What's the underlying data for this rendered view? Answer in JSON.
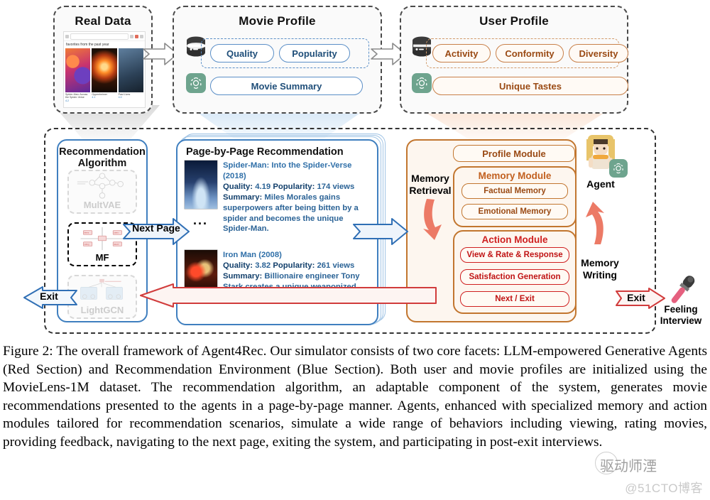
{
  "figure": {
    "top_panels": [
      {
        "id": "real-data",
        "title": "Real Data"
      },
      {
        "id": "movie-profile",
        "title": "Movie Profile"
      },
      {
        "id": "user-profile",
        "title": "User Profile"
      }
    ],
    "real_data": {
      "search_placeholder": "",
      "subheading": "favorites from the past year",
      "movies": [
        {
          "title": "Spider-Man: Across the Spider-Verse",
          "rating": "4.2"
        },
        {
          "title": "Oppenheimer",
          "rating": "4.1"
        },
        {
          "title": "Past Lives",
          "rating": "4.0"
        }
      ]
    },
    "movie_profile": {
      "attributes": [
        "Quality",
        "Popularity"
      ],
      "summary_label": "Movie Summary",
      "db_icon": "database-icon",
      "llm_icon": "openai-logo-icon"
    },
    "user_profile": {
      "attributes": [
        "Activity",
        "Conformity",
        "Diversity"
      ],
      "tastes_label": "Unique Tastes",
      "db_icon": "database-icon",
      "llm_icon": "openai-logo-icon"
    },
    "recommendation_algorithm": {
      "title_line1": "Recommendation",
      "title_line2": "Algorithm",
      "options": [
        {
          "label": "MultVAE",
          "active": false
        },
        {
          "label": "MF",
          "active": true
        },
        {
          "label": "LightGCN",
          "active": false
        }
      ]
    },
    "page_recommendation": {
      "title": "Page-by-Page Recommendation",
      "ellipsis": "...",
      "items": [
        {
          "title": "Spider-Man: Into the Spider-Verse (2018)",
          "quality_label": "Quality:",
          "quality": "4.19",
          "popularity_label": "Popularity:",
          "popularity": "174 views",
          "summary_label": "Summary:",
          "summary": "Miles Morales gains superpowers after being bitten by a spider and becomes the unique Spider-Man."
        },
        {
          "title": "Iron Man (2008)",
          "quality_label": "Quality:",
          "quality": "3.82",
          "popularity_label": "Popularity:",
          "popularity": "261 views",
          "summary_label": "Summary:",
          "summary": "Billionaire engineer Tony Stark creates a unique weaponized suit of armor to fight evil."
        }
      ]
    },
    "agent_panel": {
      "profile_module": "Profile Module",
      "memory_module": {
        "title": "Memory Module",
        "items": [
          "Factual Memory",
          "Emotional Memory"
        ]
      },
      "action_module": {
        "title": "Action Module",
        "items": [
          "View & Rate & Response",
          "Satisfaction Generation",
          "Next / Exit"
        ]
      },
      "agent_label": "Agent",
      "memory_retrieval": "Memory\nRetrieval",
      "memory_retrieval_l1": "Memory",
      "memory_retrieval_l2": "Retrieval",
      "memory_writing_l1": "Memory",
      "memory_writing_l2": "Writing",
      "avatar_icon": "agent-avatar-icon",
      "llm_icon": "openai-logo-icon"
    },
    "arrows": {
      "next_page": "Next Page",
      "exit_left": "Exit",
      "exit_right": "Exit"
    },
    "interview": {
      "label_l1": "Feeling",
      "label_l2": "Interview",
      "icon": "microphone-icon"
    },
    "colors": {
      "blue_section": "#3f7fbf",
      "red_section": "#cf2020",
      "orange_section": "#c2762f",
      "blue_text": "#2b6396",
      "arrow_red": "#d13c3c",
      "salmon_arrow": "#e8705e",
      "gpt_green": "#6ea48e"
    }
  },
  "caption": {
    "text": "Figure 2: The overall framework of Agent4Rec. Our simulator consists of two core facets: LLM-empowered Generative Agents (Red Section) and Recommendation Environment (Blue Section). Both user and movie profiles are initialized using the MovieLens-1M dataset. The recommendation algorithm, an adaptable component of the system, generates movie recommendations presented to the agents in a page-by-page manner. Agents, enhanced with specialized memory and action modules tailored for recommendation scenarios, simulate a wide range of behaviors including viewing, rating movies, providing feedback, navigating to the next page, exiting the system, and participating in post-exit interviews."
  },
  "watermark": {
    "text": "@51CTO博客",
    "overlay": "驱动师湮"
  }
}
